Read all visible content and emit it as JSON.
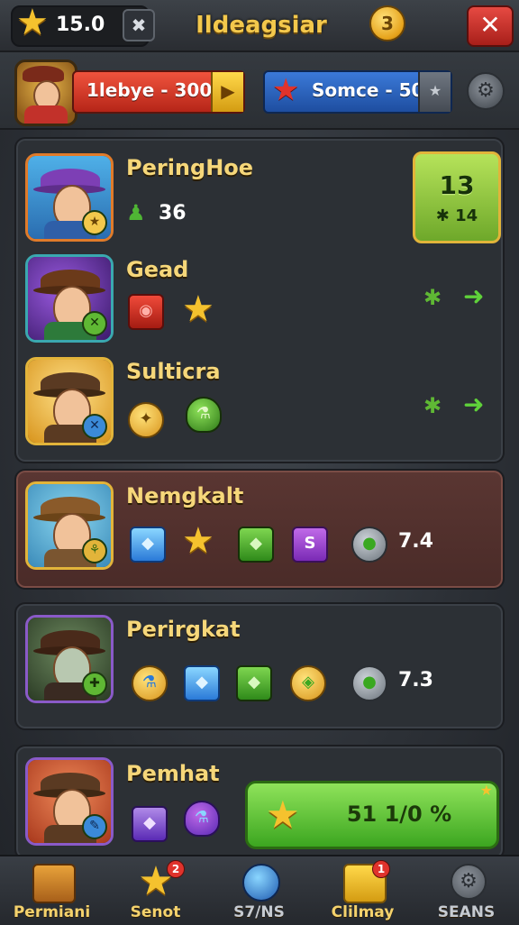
{
  "topbar": {
    "star_value": "15.0",
    "title": "Ildeagsiar",
    "coin_symbol": "3",
    "close_symbol": "✕",
    "x_symbol": "✖"
  },
  "subbar": {
    "red_label": "1lebye - 300",
    "blue_label": "Somce - 50"
  },
  "heroes": [
    {
      "name": "PeringHoe",
      "stat": "36"
    },
    {
      "name": "Gead"
    },
    {
      "name": "Sulticra"
    },
    {
      "name": "Nemgkalt",
      "value": "7.4"
    },
    {
      "name": "Perirgkat",
      "value": "7.3"
    },
    {
      "name": "Pemhat",
      "progress_label": "51 1/0 %"
    }
  ],
  "green_card": {
    "big": "13",
    "small": "14"
  },
  "bottom_nav": [
    {
      "label": "Permiani"
    },
    {
      "label": "Senot",
      "badge": "2"
    },
    {
      "label": "S7/NS"
    },
    {
      "label": "Clilmay",
      "badge": "1"
    },
    {
      "label": "SEANS"
    }
  ],
  "colors": {
    "accent_gold": "#f6d77a",
    "close_red": "#e64a42",
    "progress_green": "#5fd13a",
    "panel_maroon": "#5a3632"
  }
}
